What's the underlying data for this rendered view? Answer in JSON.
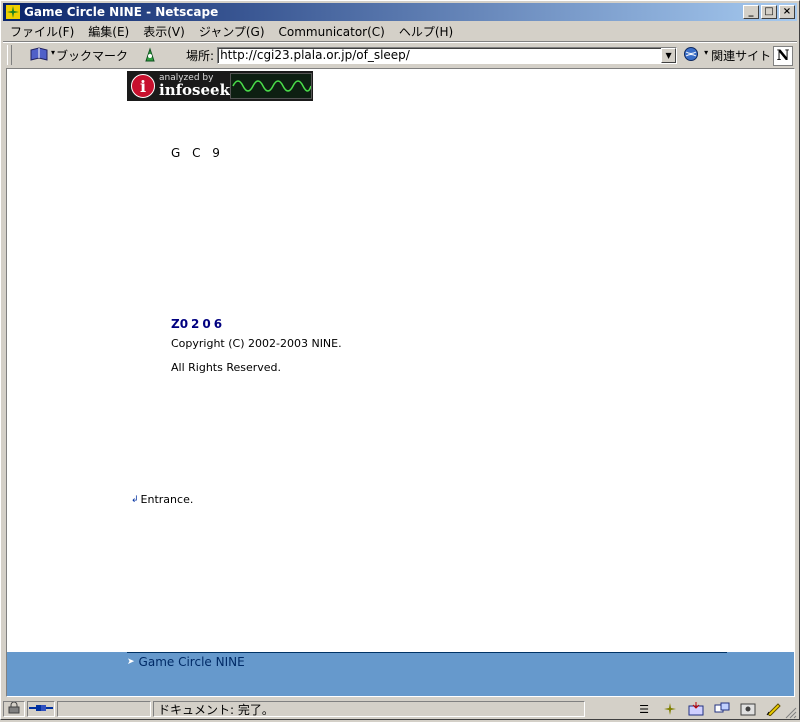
{
  "window": {
    "title": "Game Circle NINE - Netscape"
  },
  "menu": [
    "ファイル(F)",
    "編集(E)",
    "表示(V)",
    "ジャンプ(G)",
    "Communicator(C)",
    "ヘルプ(H)"
  ],
  "toolbar": {
    "bookmarks_label": "ブックマーク",
    "location_label": "場所:",
    "url": "http://cgi23.plala.or.jp/of_sleep/",
    "related_label": "関連サイト"
  },
  "page": {
    "banner": {
      "by": "analyzed by",
      "brand": "infoseek"
    },
    "heading": "G C 9",
    "counter": "0206",
    "copyright": "Copyright (C) 2002-2003 NINE.",
    "rights": "All Rights Reserved.",
    "entrance": "Entrance.",
    "footer_link": "Game Circle NINE"
  },
  "status": {
    "text": "ドキュメント: 完了。"
  },
  "colors": {
    "titlebar": "#0a246a",
    "footer": "#6699cc",
    "chrome": "#d4d0c8"
  }
}
